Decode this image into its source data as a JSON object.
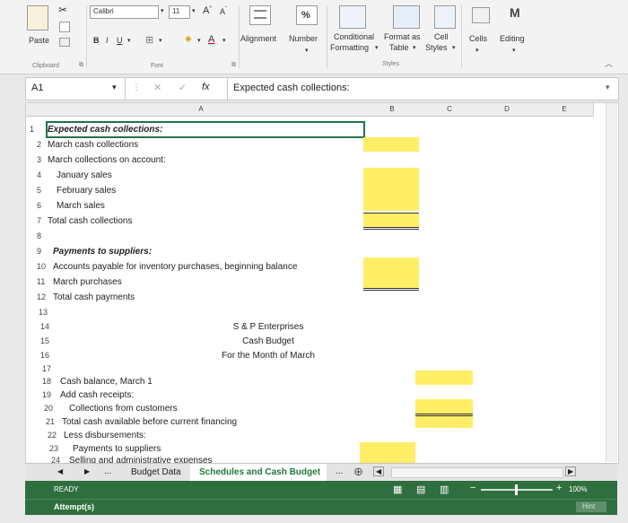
{
  "ribbon": {
    "font_name": "Calibri",
    "font_size": "11",
    "paste_label": "Paste",
    "percent_symbol": "%",
    "alignment_label": "Alignment",
    "number_label": "Number",
    "conditional_label_1": "Conditional",
    "conditional_label_2": "Formatting",
    "format_as_label_1": "Format as",
    "format_as_label_2": "Table",
    "cell_label_1": "Cell",
    "cell_label_2": "Styles",
    "cells_label": "Cells",
    "editing_label": "Editing",
    "groups": {
      "clipboard": "Clipboard",
      "font": "Font",
      "styles": "Styles"
    }
  },
  "formula_bar": {
    "cell_ref": "A1",
    "fx": "fx",
    "content": "Expected cash collections:"
  },
  "columns": [
    "A",
    "B",
    "C",
    "D",
    "E"
  ],
  "rows": [
    {
      "n": "1",
      "text": "Expected cash collections:"
    },
    {
      "n": "2",
      "text": "March cash collections"
    },
    {
      "n": "3",
      "text": "March collections on account:"
    },
    {
      "n": "4",
      "text": "January sales"
    },
    {
      "n": "5",
      "text": "February sales"
    },
    {
      "n": "6",
      "text": "March sales"
    },
    {
      "n": "7",
      "text": "Total cash collections"
    },
    {
      "n": "8",
      "text": ""
    },
    {
      "n": "9",
      "text": "Payments to suppliers:"
    },
    {
      "n": "10",
      "text": "Accounts payable for inventory purchases, beginning balance"
    },
    {
      "n": "11",
      "text": "March purchases"
    },
    {
      "n": "12",
      "text": "Total cash payments"
    },
    {
      "n": "13",
      "text": ""
    },
    {
      "n": "14",
      "text": "S & P Enterprises"
    },
    {
      "n": "15",
      "text": "Cash Budget"
    },
    {
      "n": "16",
      "text": "For the Month of March"
    },
    {
      "n": "17",
      "text": ""
    },
    {
      "n": "18",
      "text": "Cash balance, March 1"
    },
    {
      "n": "19",
      "text": "Add cash receipts:"
    },
    {
      "n": "20",
      "text": "Collections from customers"
    },
    {
      "n": "21",
      "text": "Total cash available before current financing"
    },
    {
      "n": "22",
      "text": "Less disbursements:"
    },
    {
      "n": "23",
      "text": "Payments to suppliers"
    },
    {
      "n": "24",
      "text": "Selling and administrative expenses"
    }
  ],
  "tabs": {
    "ellipsis": "...",
    "budget_data": "Budget Data",
    "schedules": "Schedules and Cash Budget",
    "more": "..."
  },
  "status": {
    "ready": "READY",
    "zoom": "100%",
    "attempts": "Attempt(s)",
    "hint": "Hint"
  },
  "colors": {
    "highlight": "#ffee66",
    "status_bar": "#2f6f3f",
    "active_tab": "#1e7a3a"
  }
}
